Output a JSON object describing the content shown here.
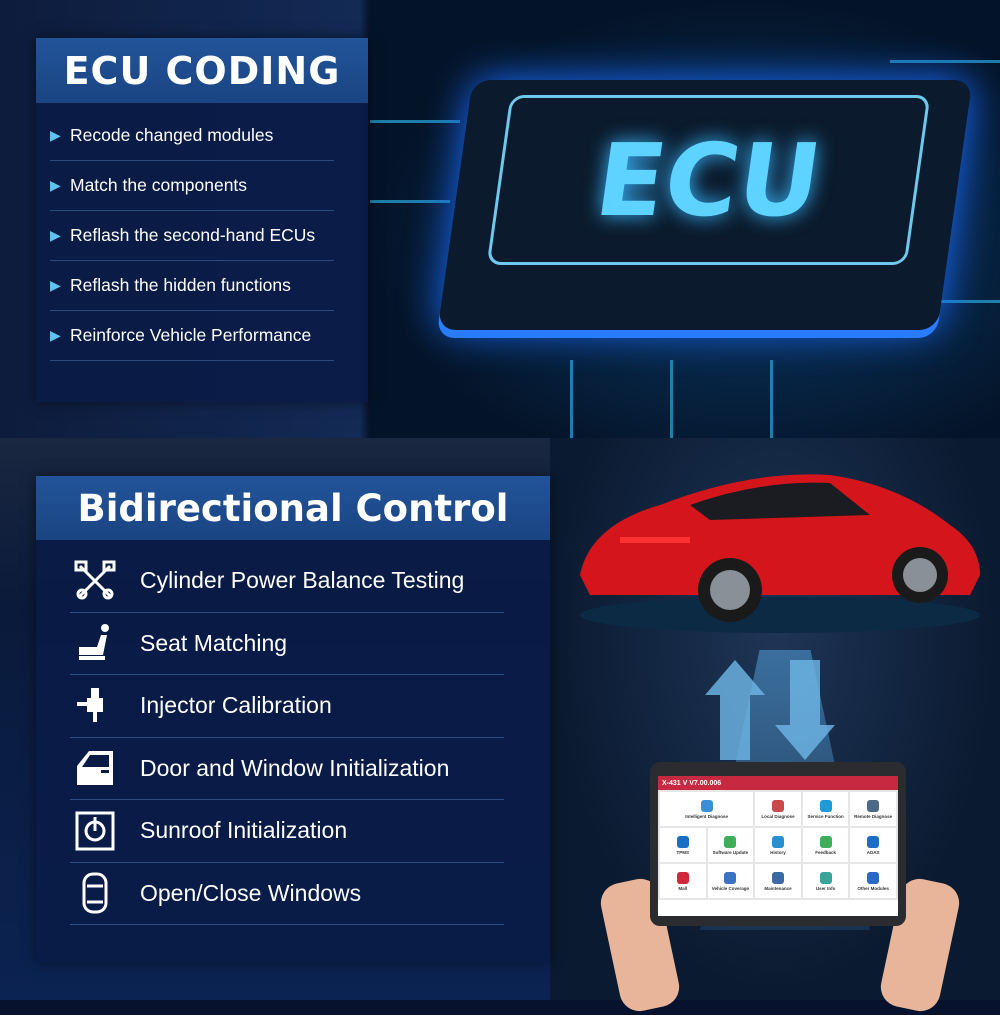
{
  "ecu_coding": {
    "title": "ECU CODING",
    "items": [
      "Recode changed modules",
      "Match the components",
      "Reflash the second-hand ECUs",
      "Reflash the hidden functions",
      "Reinforce Vehicle Performance"
    ]
  },
  "chip": {
    "label": "ECU"
  },
  "bidirectional": {
    "title": "Bidirectional Control",
    "items": [
      {
        "label": "Cylinder Power Balance Testing",
        "icon": "pistons-icon"
      },
      {
        "label": "Seat Matching",
        "icon": "seat-icon"
      },
      {
        "label": "Injector Calibration",
        "icon": "injector-icon"
      },
      {
        "label": "Door and Window Initialization",
        "icon": "car-door-icon"
      },
      {
        "label": "Sunroof Initialization",
        "icon": "sunroof-icon"
      },
      {
        "label": "Open/Close Windows",
        "icon": "car-top-icon"
      }
    ]
  },
  "tablet": {
    "title": "X-431 V V7.00.006",
    "apps": [
      {
        "label": "Intelligent Diagnose",
        "color": "#3a8fd6"
      },
      {
        "label": "Local Diagnose",
        "color": "#c84a4a"
      },
      {
        "label": "Service Function",
        "color": "#1e9ad6"
      },
      {
        "label": "Remote Diagnose",
        "color": "#4a6a86"
      },
      {
        "label": "TPMS",
        "color": "#1a6fc4"
      },
      {
        "label": "Software Update",
        "color": "#3fae5a"
      },
      {
        "label": "History",
        "color": "#2a8fd0"
      },
      {
        "label": "Feedback",
        "color": "#3fae5a"
      },
      {
        "label": "ADAS",
        "color": "#1a6fc4"
      },
      {
        "label": "Mall",
        "color": "#d0283a"
      },
      {
        "label": "Vehicle Coverage",
        "color": "#3a72c4"
      },
      {
        "label": "Maintenance",
        "color": "#3a6aa4"
      },
      {
        "label": "User Info",
        "color": "#3aa49a"
      },
      {
        "label": "Other Modules",
        "color": "#2a6ac4"
      }
    ]
  },
  "colors": {
    "panel_header": "#22549a",
    "panel_body": "#0a1b46",
    "accent": "#5cc4f0",
    "tablet_bar": "#c72a40",
    "car": "#d4161c"
  }
}
